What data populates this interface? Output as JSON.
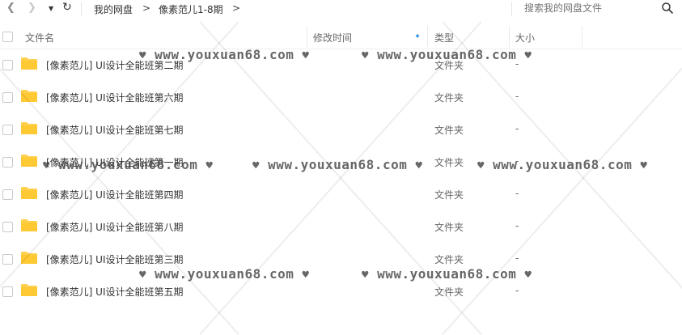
{
  "toolbar": {
    "back_icon": "chevron-left-icon",
    "forward_icon": "chevron-right-icon",
    "dropdown_icon": "caret-down-icon",
    "refresh_icon": "refresh-icon"
  },
  "breadcrumb": {
    "root": "我的网盘",
    "current": "像素范儿1-8期"
  },
  "search": {
    "placeholder": "搜索我的网盘文件"
  },
  "columns": {
    "name": "文件名",
    "modified": "修改时间",
    "type": "类型",
    "size": "大小"
  },
  "sort_indicator": "arrow-down-icon",
  "files": [
    {
      "name": "[像素范儿] UI设计全能班第二期",
      "type": "文件夹",
      "size": "-"
    },
    {
      "name": "[像素范儿] UI设计全能班第六期",
      "type": "文件夹",
      "size": "-"
    },
    {
      "name": "[像素范儿] UI设计全能班第七期",
      "type": "文件夹",
      "size": "-"
    },
    {
      "name": "[像素范儿] UI设计全能班第一期",
      "type": "文件夹",
      "size": "-"
    },
    {
      "name": "[像素范儿] UI设计全能班第四期",
      "type": "文件夹",
      "size": "-"
    },
    {
      "name": "[像素范儿] UI设计全能班第八期",
      "type": "文件夹",
      "size": "-"
    },
    {
      "name": "[像素范儿] UI设计全能班第三期",
      "type": "文件夹",
      "size": "-"
    },
    {
      "name": "[像素范儿] UI设计全能班第五期",
      "type": "文件夹",
      "size": "-"
    }
  ],
  "watermark": {
    "text": "www.youxuan68.com",
    "heart": "♥"
  },
  "colors": {
    "folder": "#ffd04b",
    "accent": "#1a8cf0"
  }
}
